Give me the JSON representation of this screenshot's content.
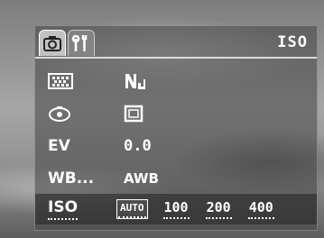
{
  "tabs": [
    {
      "icon": "camera-icon",
      "active": true
    },
    {
      "icon": "setup-tools-icon",
      "active": false
    }
  ],
  "menu_title": "ISO",
  "rows": [
    {
      "label_icon": "picture-quality-icon",
      "value_icon": "normal-compression-icon"
    },
    {
      "label_icon": "metering-icon",
      "value_icon": "center-weighted-icon"
    },
    {
      "label": "EV",
      "value": "0.0"
    },
    {
      "label": "WB...",
      "value": "AWB"
    },
    {
      "label": "ISO",
      "options": [
        "AUTO",
        "100",
        "200",
        "400"
      ],
      "selected": "AUTO"
    }
  ]
}
